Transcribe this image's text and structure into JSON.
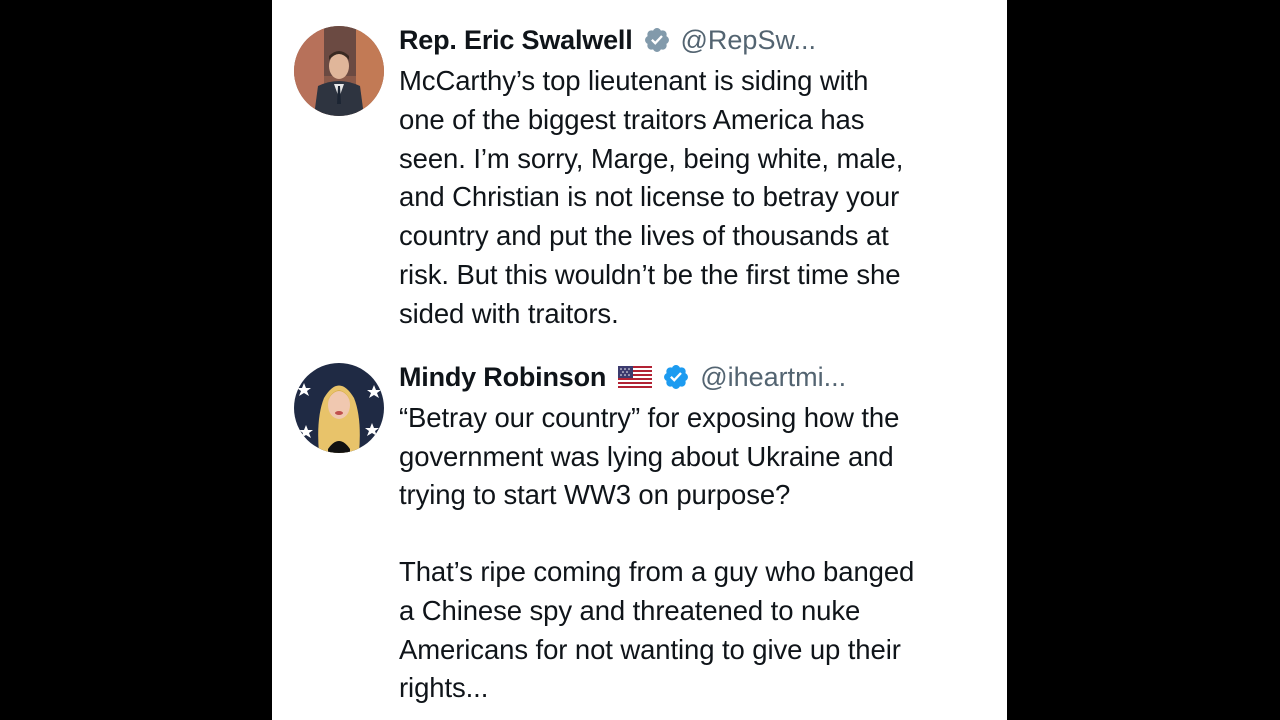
{
  "tweets": [
    {
      "author_name": "Rep. Eric Swalwell",
      "handle": "@RepSw...",
      "verified": true,
      "flag": "",
      "text": "McCarthy’s top lieutenant is siding with\none of the biggest traitors America has\nseen. I’m sorry, Marge, being white, male,\nand Christian is not license to betray your\ncountry and put the lives of thousands at\nrisk. But this wouldn’t be the first time she\nsided with traitors."
    },
    {
      "author_name": "Mindy Robinson",
      "handle": "@iheartmi...",
      "verified": true,
      "flag": "us-flag-icon",
      "text": "“Betray our country” for exposing how the\ngovernment was lying about Ukraine and\ntrying to start WW3 on purpose?\n\nThat’s ripe coming from a guy who banged\na Chinese spy and threatened to nuke\nAmericans for not wanting to give up their\nrights..."
    }
  ],
  "colors": {
    "background": "#000000",
    "panel": "#ffffff",
    "text": "#0f1419",
    "handle": "#536471",
    "verified_badge": "#1d9bf0"
  }
}
